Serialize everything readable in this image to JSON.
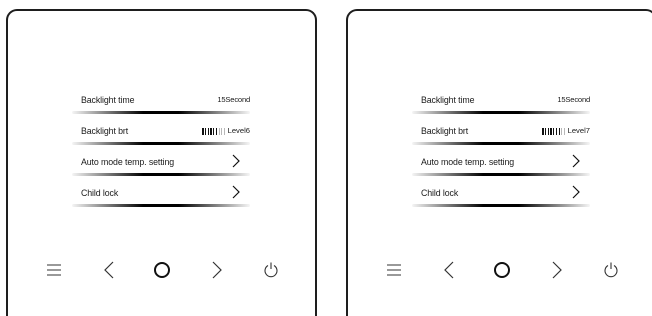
{
  "panels": [
    {
      "menu": {
        "backlight_time": {
          "label": "Backlight time",
          "value": "15Second"
        },
        "backlight_brt": {
          "label": "Backlight brt",
          "value": "Level6",
          "level": 6,
          "max_level": 9
        },
        "auto_mode": {
          "label": "Auto mode temp. setting"
        },
        "child_lock": {
          "label": "Child lock"
        }
      }
    },
    {
      "menu": {
        "backlight_time": {
          "label": "Backlight time",
          "value": "15Second"
        },
        "backlight_brt": {
          "label": "Backlight brt",
          "value": "Level7",
          "level": 7,
          "max_level": 9
        },
        "auto_mode": {
          "label": "Auto mode temp. setting"
        },
        "child_lock": {
          "label": "Child lock"
        }
      }
    }
  ],
  "nav_icons": [
    "menu-icon",
    "left-arrow-icon",
    "confirm-circle-icon",
    "right-arrow-icon",
    "power-icon"
  ]
}
